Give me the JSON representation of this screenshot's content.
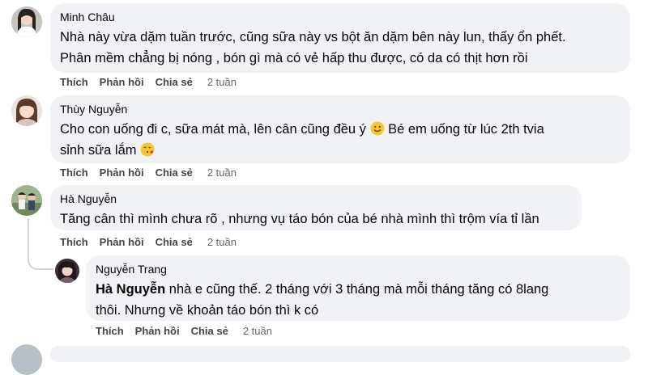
{
  "comments": [
    {
      "author": "Minh Châu",
      "lines": [
        "Nhà này vừa dặm tuần trước, cũng sữa này vs bột ăn dặm bên này lun, thấy ổn phết.",
        "Phân mềm chẳng bị nóng , bón gì mà có vẻ hấp thu được, có da có thịt hơn rồi"
      ],
      "like": "Thích",
      "reply": "Phản hồi",
      "share": "Chia sẻ",
      "time": "2 tuần"
    },
    {
      "author": "Thùy Nguyễn",
      "line1_a": "Cho con uống đi c, sữa mát mà, lên cân cũng đều ý",
      "line1_b": "Bé em uống từ lúc 2th tvia",
      "line2": "sỉnh sữa lắm",
      "like": "Thích",
      "reply": "Phản hồi",
      "share": "Chia sẻ",
      "time": "2 tuần"
    },
    {
      "author": "Hà Nguyễn",
      "lines": [
        "Tăng cân thì mình chưa rõ , nhưng vụ táo bón của bé nhà mình thì trộm vía tỉ lần"
      ],
      "like": "Thích",
      "reply": "Phản hồi",
      "share": "Chia sẻ",
      "time": "2 tuần"
    }
  ],
  "reply": {
    "author": "Nguyễn Trang",
    "mention": "Hà Nguyễn",
    "line1": "nhà e cũng thế. 2 tháng với 3 tháng mà mỗi tháng tăng có 8lang",
    "line2": "thôi. Nhưng về khoản táo bón thì k có",
    "like": "Thích",
    "reply": "Phản hồi",
    "share": "Chia sẻ",
    "time": "2 tuần"
  },
  "emojis": [
    "slightly-smiling-face",
    "face-blowing-kiss"
  ]
}
